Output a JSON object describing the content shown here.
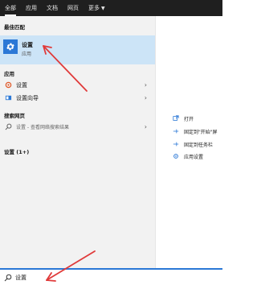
{
  "tabs": [
    {
      "label": "全部"
    },
    {
      "label": "应用"
    },
    {
      "label": "文档"
    },
    {
      "label": "网页"
    },
    {
      "label": "更多"
    }
  ],
  "sections": {
    "best_match": "最佳匹配",
    "apps": "应用",
    "web": "搜索网页",
    "settings": "设置 (1+)"
  },
  "best_match": {
    "title": "设置",
    "subtitle": "应用",
    "icon": "gear-icon"
  },
  "apps": [
    {
      "label": "设置",
      "icon": "settings-app-icon"
    },
    {
      "label": "设置向导",
      "icon": "wizard-icon"
    }
  ],
  "web_result": {
    "label": "设置 - 查看网络搜索结果",
    "icon": "search-icon"
  },
  "actions": [
    {
      "label": "打开",
      "icon": "open-icon"
    },
    {
      "label": "固定到\"开始\"屏",
      "icon": "pin-icon"
    },
    {
      "label": "固定到任务栏",
      "icon": "pin-icon"
    },
    {
      "label": "应用设置",
      "icon": "gear-icon"
    }
  ],
  "search": {
    "value": "设置"
  },
  "colors": {
    "accent": "#2b78d6",
    "highlight": "#cce4f7",
    "annotation": "#e03a3a",
    "topbar": "#1f1f1f"
  }
}
